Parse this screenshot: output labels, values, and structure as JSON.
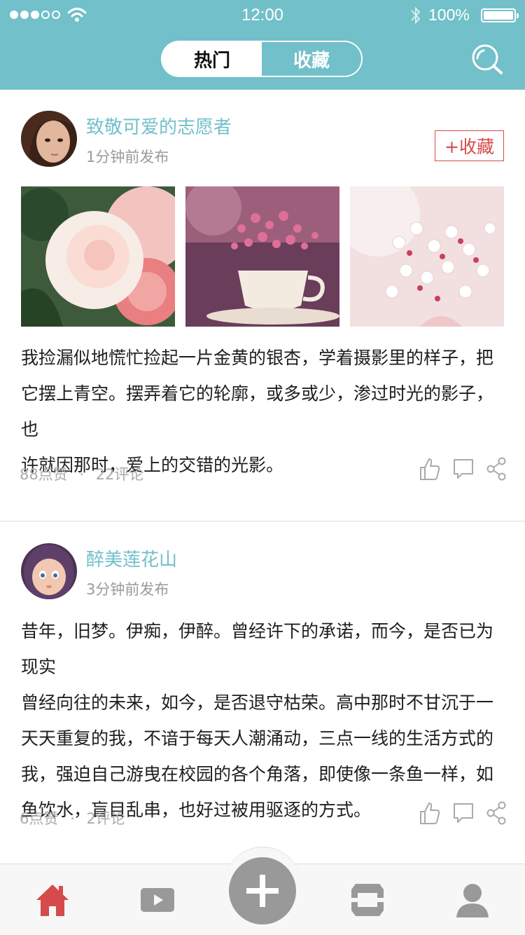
{
  "status_bar": {
    "time": "12:00",
    "battery": "100%",
    "signal_icon": "cellular-signal-icon",
    "wifi_icon": "wifi-icon",
    "bluetooth_icon": "bluetooth-icon",
    "battery_icon": "battery-icon"
  },
  "header": {
    "tabs": [
      {
        "label": "热门",
        "selected": true
      },
      {
        "label": "收藏",
        "selected": false
      }
    ],
    "search_icon": "search-icon",
    "accent_color": "#72c0c9"
  },
  "posts": [
    {
      "username": "致敬可爱的志愿者",
      "time": "1分钟前发布",
      "favorite_label": "+收藏",
      "images": [
        "rose-photo",
        "teacup-flowers-photo",
        "white-blossoms-photo"
      ],
      "content_lines": [
        "我捡漏似地慌忙捡起一片金黄的银杏，学着摄影里的样子，把",
        "它摆上青空。摆弄着它的轮廓，或多或少，渗过时光的影子，也",
        "许就因那时，爱上的交错的光影。"
      ],
      "likes": "88点赞",
      "separator": "·",
      "comments": "22评论"
    },
    {
      "username": "醉美莲花山",
      "time": "3分钟前发布",
      "content_lines": [
        "昔年，旧梦。伊痴，伊醉。曾经许下的承诺，而今，是否已为现实",
        "曾经向往的未来，如今，是否退守枯荣。高中那时不甘沉于一",
        "天天重复的我，不谙于每天人潮涌动，三点一线的生活方式的",
        "我，强迫自己游曳在校园的各个角落，即使像一条鱼一样，如",
        "鱼饮水，盲目乱串，也好过被用驱逐的方式。"
      ],
      "likes": "6点赞",
      "separator": "·",
      "comments": "2评论"
    }
  ],
  "tabbar": {
    "items": [
      "home-icon",
      "video-icon",
      "add-icon",
      "shop-icon",
      "profile-icon"
    ],
    "active_color": "#d54a4a",
    "inactive_color": "#999999"
  }
}
